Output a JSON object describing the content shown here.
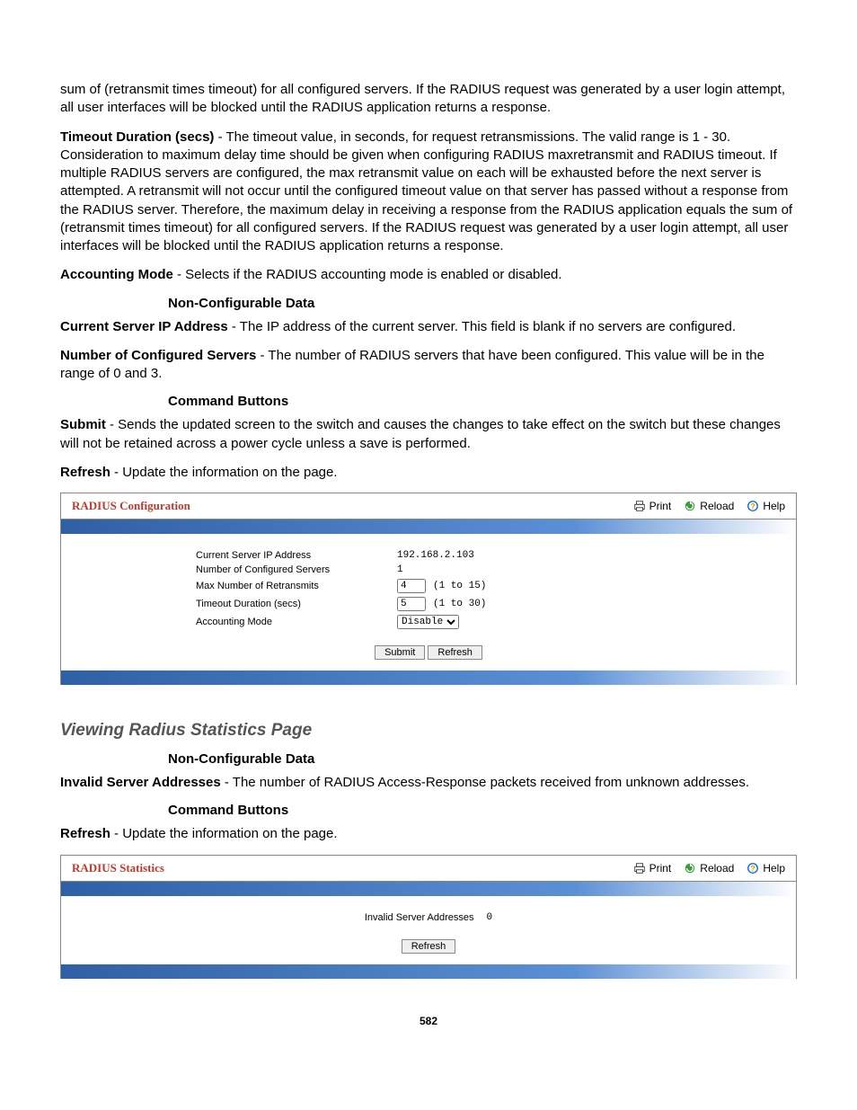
{
  "doc": {
    "intro_cont": "sum of (retransmit times timeout) for all configured servers. If the RADIUS request was generated by a user login attempt, all user interfaces will be blocked until the RADIUS application returns a response.",
    "timeout_label": "Timeout Duration (secs)",
    "timeout_text": " - The timeout value, in seconds, for request retransmissions. The valid range is 1 - 30. Consideration to maximum delay time should be given when configuring RADIUS maxretransmit and RADIUS timeout. If multiple RADIUS servers are configured, the max retransmit value on each will be exhausted before the next server is attempted. A retransmit will not occur until the configured timeout value on that server has passed without a response from the RADIUS server. Therefore, the maximum delay in receiving a response from the RADIUS application equals the sum of (retransmit times timeout) for all configured servers. If the RADIUS request was generated by a user login attempt, all user interfaces will be blocked until the RADIUS application returns a response.",
    "acct_label": "Accounting Mode",
    "acct_text": " - Selects if the RADIUS accounting mode is enabled or disabled.",
    "noncfg_heading": "Non-Configurable Data",
    "curip_label": "Current Server IP Address",
    "curip_text": " - The IP address of the current server. This field is blank if no servers are configured.",
    "numsrv_label": "Number of Configured Servers",
    "numsrv_text": " - The number of RADIUS servers that have been configured. This value will be in the range of 0 and 3.",
    "cmd_heading": "Command Buttons",
    "submit_label": "Submit",
    "submit_text": " - Sends the updated screen to the switch and causes the changes to take effect on the switch but these changes will not be retained across a power cycle unless a save is performed.",
    "refresh_label": "Refresh",
    "refresh_text": " - Update the information on the page.",
    "page_number": "582"
  },
  "panel1": {
    "title": "RADIUS Configuration",
    "print": "Print",
    "reload": "Reload",
    "help": "Help",
    "rows": {
      "cur_ip_label": "Current Server IP Address",
      "cur_ip_value": "192.168.2.103",
      "num_srv_label": "Number of Configured Servers",
      "num_srv_value": "1",
      "max_retrans_label": "Max Number of Retransmits",
      "max_retrans_value": "4",
      "max_retrans_hint": "(1 to 15)",
      "timeout_label": "Timeout Duration (secs)",
      "timeout_value": "5",
      "timeout_hint": "(1 to 30)",
      "acct_label": "Accounting Mode",
      "acct_value": "Disable"
    },
    "submit_btn": "Submit",
    "refresh_btn": "Refresh"
  },
  "section2": {
    "heading": "Viewing Radius Statistics Page",
    "noncfg_heading": "Non-Configurable Data",
    "invalid_label": "Invalid Server Addresses",
    "invalid_text": " - The number of RADIUS Access-Response packets received from unknown addresses.",
    "cmd_heading": "Command Buttons",
    "refresh_label": "Refresh",
    "refresh_text": " - Update the information on the page."
  },
  "panel2": {
    "title": "RADIUS Statistics",
    "print": "Print",
    "reload": "Reload",
    "help": "Help",
    "row_label": "Invalid Server Addresses",
    "row_value": "0",
    "refresh_btn": "Refresh"
  }
}
